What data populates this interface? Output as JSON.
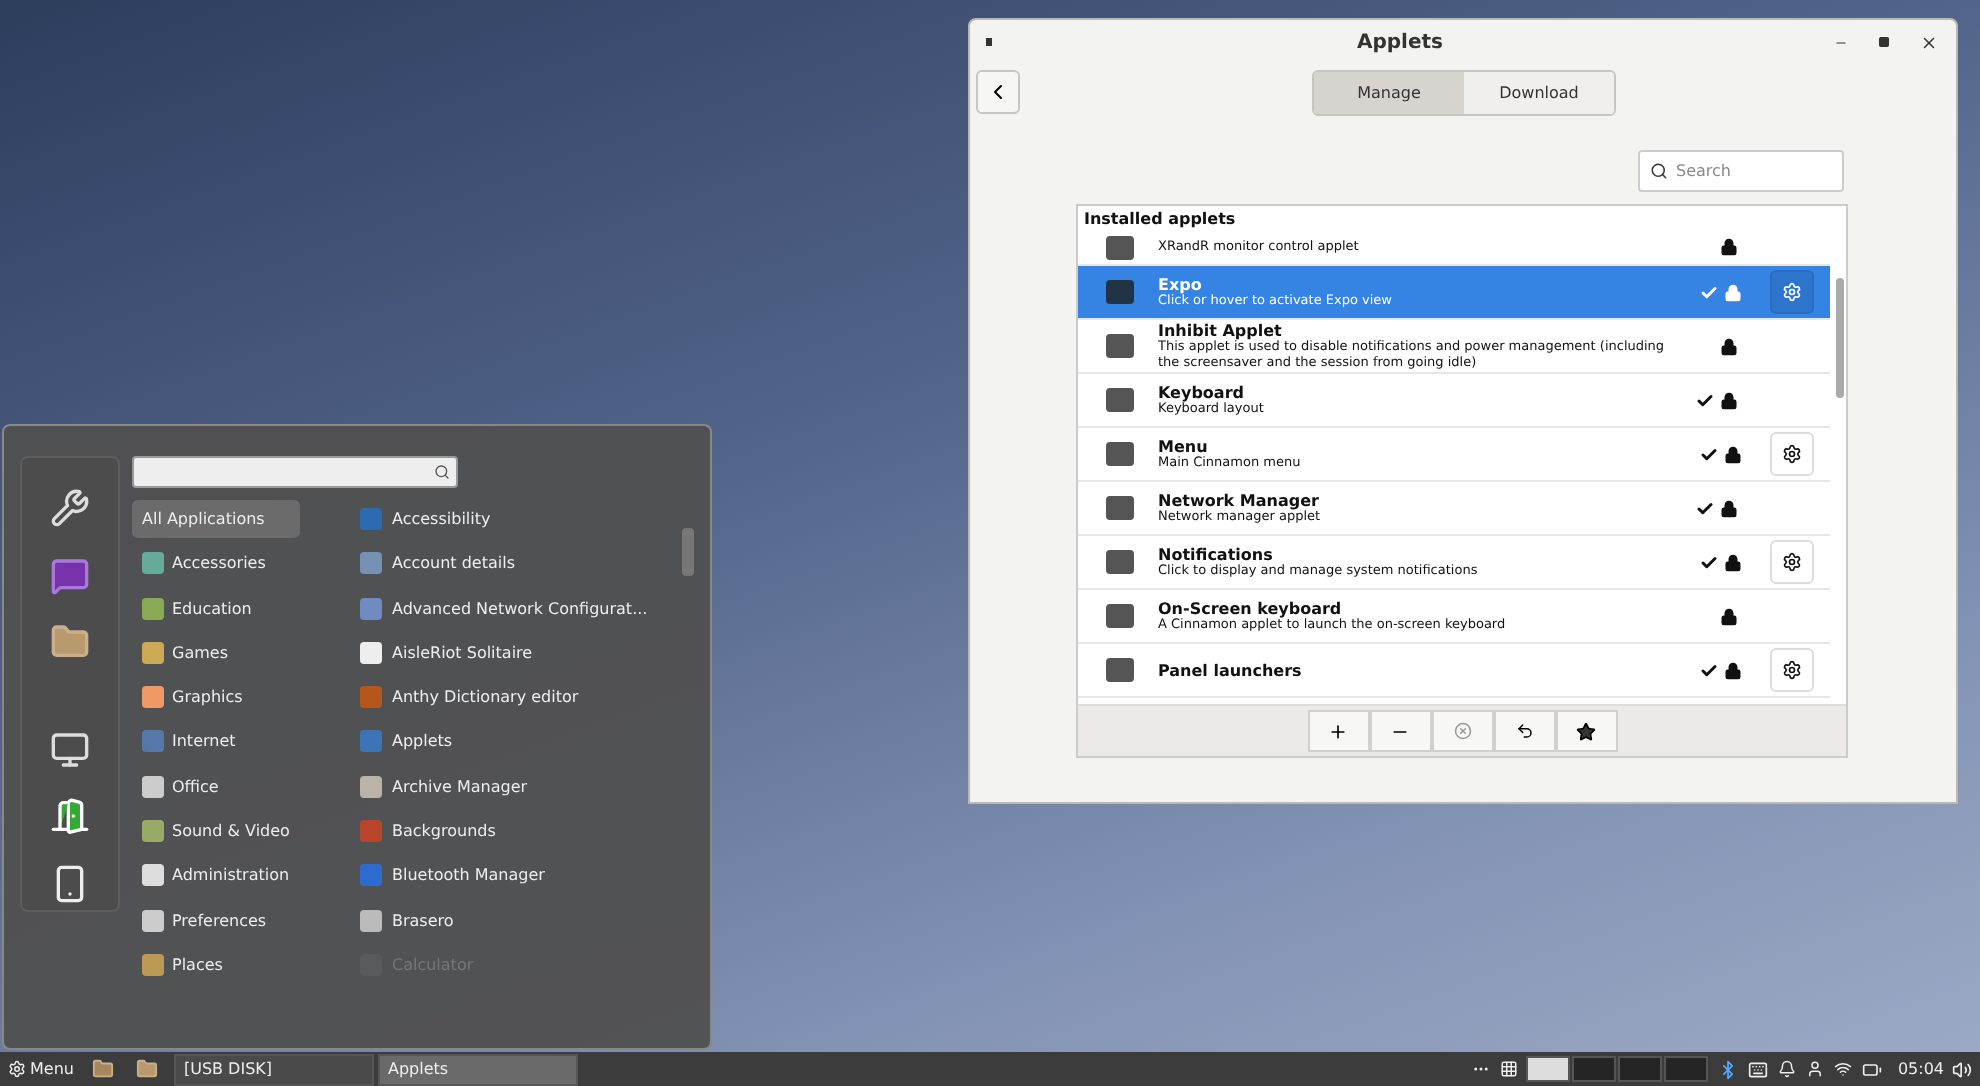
{
  "applets_window": {
    "title": "Applets",
    "tabs": [
      {
        "label": "Manage",
        "selected": true
      },
      {
        "label": "Download",
        "selected": false
      }
    ],
    "search": {
      "placeholder": "Search"
    },
    "list_header": "Installed applets",
    "applets": [
      {
        "kind": "partial",
        "description": "XRandR monitor control applet",
        "enabled": false,
        "configurable": false,
        "selected": false
      },
      {
        "kind": "full",
        "name": "Expo",
        "description": "Click or hover to activate Expo view",
        "enabled": true,
        "configurable": true,
        "selected": true
      },
      {
        "kind": "full",
        "name": "Inhibit Applet",
        "description": "This applet is used to disable notifications and power management (including the screensaver and the session from going idle)",
        "enabled": false,
        "configurable": false,
        "selected": false
      },
      {
        "kind": "full",
        "name": "Keyboard",
        "description": "Keyboard layout",
        "enabled": true,
        "configurable": false,
        "selected": false
      },
      {
        "kind": "full",
        "name": "Menu",
        "description": "Main Cinnamon menu",
        "enabled": true,
        "configurable": true,
        "selected": false
      },
      {
        "kind": "full",
        "name": "Network Manager",
        "description": "Network manager applet",
        "enabled": true,
        "configurable": false,
        "selected": false
      },
      {
        "kind": "full",
        "name": "Notifications",
        "description": "Click to display and manage system notifications",
        "enabled": true,
        "configurable": true,
        "selected": false
      },
      {
        "kind": "full",
        "name": "On-Screen keyboard",
        "description": "A Cinnamon applet to launch the on-screen keyboard",
        "enabled": false,
        "configurable": false,
        "selected": false
      },
      {
        "kind": "full",
        "name": "Panel launchers",
        "enabled": true,
        "configurable": true,
        "selected": false
      }
    ]
  },
  "menu": {
    "categories": [
      {
        "label": "All Applications",
        "selected": true
      },
      {
        "label": "Accessories",
        "selected": false
      },
      {
        "label": "Education",
        "selected": false
      },
      {
        "label": "Games",
        "selected": false
      },
      {
        "label": "Graphics",
        "selected": false
      },
      {
        "label": "Internet",
        "selected": false
      },
      {
        "label": "Office",
        "selected": false
      },
      {
        "label": "Sound & Video",
        "selected": false
      },
      {
        "label": "Administration",
        "selected": false
      },
      {
        "label": "Preferences",
        "selected": false
      },
      {
        "label": "Places",
        "selected": false
      }
    ],
    "apps": [
      {
        "label": "Accessibility",
        "dimmed": false
      },
      {
        "label": "Account details",
        "dimmed": false
      },
      {
        "label": "Advanced Network Configurat...",
        "dimmed": false
      },
      {
        "label": "AisleRiot Solitaire",
        "dimmed": false
      },
      {
        "label": "Anthy Dictionary editor",
        "dimmed": false
      },
      {
        "label": "Applets",
        "dimmed": false
      },
      {
        "label": "Archive Manager",
        "dimmed": false
      },
      {
        "label": "Backgrounds",
        "dimmed": false
      },
      {
        "label": "Bluetooth Manager",
        "dimmed": false
      },
      {
        "label": "Brasero",
        "dimmed": false
      },
      {
        "label": "Calculator",
        "dimmed": true
      }
    ]
  },
  "taskbar": {
    "menu_label": "Menu",
    "windows": [
      {
        "label": "[USB DISK]",
        "selected": false
      },
      {
        "label": "Applets",
        "selected": true
      }
    ],
    "workspaces": [
      {
        "selected": true
      },
      {
        "selected": false
      },
      {
        "selected": false
      },
      {
        "selected": false
      }
    ],
    "clock": "05:04"
  }
}
